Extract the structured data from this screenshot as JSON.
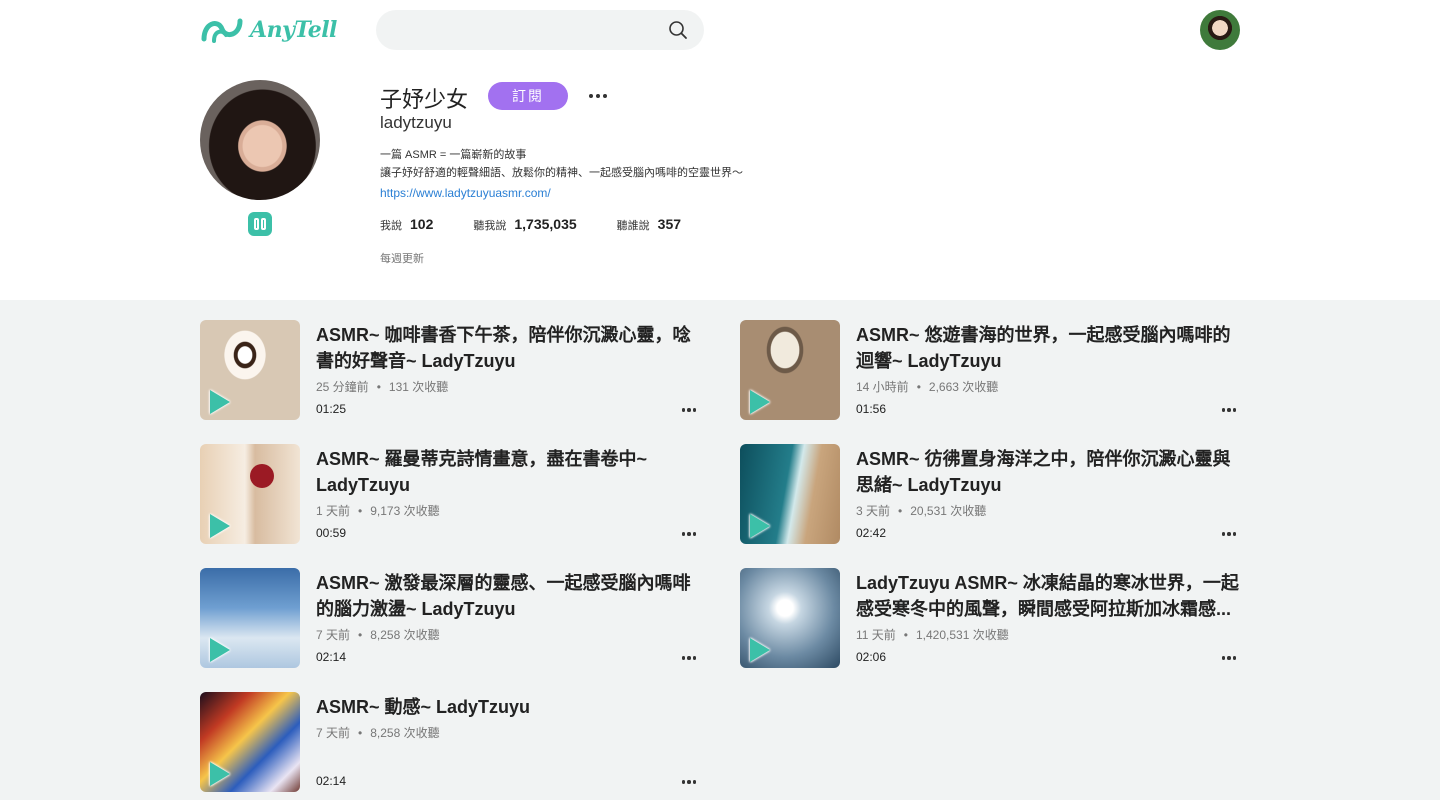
{
  "header": {
    "logo_text": "AnyTell",
    "search_placeholder": ""
  },
  "profile": {
    "name": "子妤少女",
    "subscribe_label": "訂閱",
    "handle": "ladytzuyu",
    "bio_line1": "一篇 ASMR = 一篇嶄新的故事",
    "bio_line2": "讓子妤好舒適的輕聲細語、放鬆你的精神、一起感受腦內嗎啡的空靈世界～",
    "link": "https://www.ladytzuyuasmr.com/",
    "stats": [
      {
        "label": "我說",
        "value": "102"
      },
      {
        "label": "聽我說",
        "value": "1,735,035"
      },
      {
        "label": "聽誰說",
        "value": "357"
      }
    ],
    "update_text": "每週更新"
  },
  "episodes": [
    {
      "title": "ASMR~ 咖啡書香下午茶，陪伴你沉澱心靈，唸書的好聲音~ LadyTzuyu",
      "time": "25 分鐘前",
      "plays": "131 次收聽",
      "duration": "01:25"
    },
    {
      "title": "ASMR~ 悠遊書海的世界，一起感受腦內嗎啡的迴響~ LadyTzuyu",
      "time": "14 小時前",
      "plays": "2,663 次收聽",
      "duration": "01:56"
    },
    {
      "title": "ASMR~ 羅曼蒂克詩情畫意，盡在書卷中~ LadyTzuyu",
      "time": "1 天前",
      "plays": "9,173 次收聽",
      "duration": "00:59"
    },
    {
      "title": "ASMR~ 彷彿置身海洋之中，陪伴你沉澱心靈與思緒~ LadyTzuyu",
      "time": "3 天前",
      "plays": "20,531 次收聽",
      "duration": "02:42"
    },
    {
      "title": "ASMR~ 激發最深層的靈感、一起感受腦內嗎啡的腦力激盪~ LadyTzuyu",
      "time": "7 天前",
      "plays": "8,258 次收聽",
      "duration": "02:14"
    },
    {
      "title": "LadyTzuyu ASMR~ 冰凍結晶的寒冰世界，一起感受寒冬中的風聲，瞬間感受阿拉斯加冰霜感...",
      "time": "11 天前",
      "plays": "1,420,531 次收聽",
      "duration": "02:06"
    },
    {
      "title": "ASMR~ 動感~ LadyTzuyu",
      "time": "7 天前",
      "plays": "8,258 次收聽",
      "duration": "02:14"
    }
  ],
  "colors": {
    "accent": "#3cc0a8",
    "subscribe": "#a271f0",
    "link": "#2a7fd4",
    "feed_bg": "#f1f3f3"
  },
  "icons": [
    "anytell-logo-icon",
    "search-icon",
    "more-icon",
    "play-icon",
    "pause-badge-icon"
  ]
}
